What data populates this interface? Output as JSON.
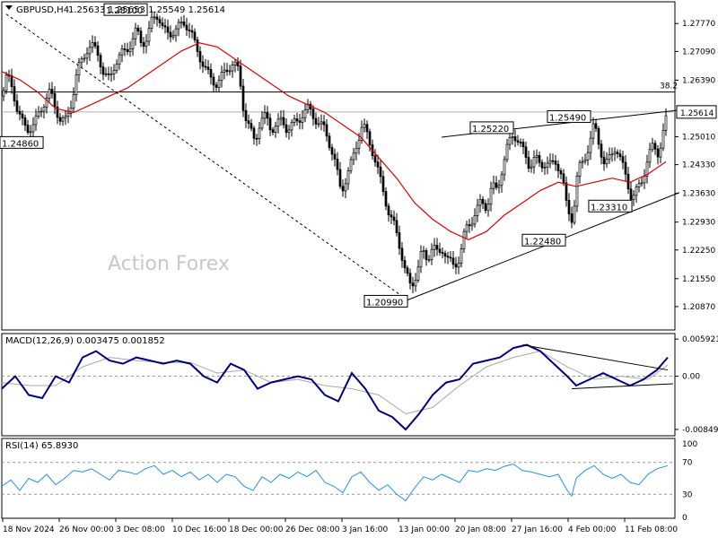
{
  "chart_data": [
    {
      "type": "candlestick",
      "symbol": "GBPUSD",
      "timeframe": "H4",
      "header": {
        "symbol_tf": "GBPUSD,H4",
        "ohlc": "1.25633 1.25653 1.25549 1.25614"
      },
      "last_price": "1.25614",
      "watermark": "Action Forex",
      "ylim": [
        1.203,
        1.283
      ],
      "y_ticks": [
        "1.27770",
        "1.27090",
        "1.26390",
        "1.25010",
        "1.24330",
        "1.23630",
        "1.22930",
        "1.22250",
        "1.21550",
        "1.20870"
      ],
      "x_ticks": [
        "18 Nov 2024",
        "26 Nov 00:00",
        "3 Dec 08:00",
        "10 Dec 16:00",
        "18 Dec 00:00",
        "26 Dec 08:00",
        "3 Jan 16:00",
        "13 Jan 00:00",
        "20 Jan 08:00",
        "27 Jan 16:00",
        "4 Feb 00:00",
        "11 Feb 08:00"
      ],
      "close_path": [
        [
          0,
          1.26
        ],
        [
          6,
          1.265
        ],
        [
          12,
          1.262
        ],
        [
          18,
          1.256
        ],
        [
          24,
          1.253
        ],
        [
          30,
          1.252
        ],
        [
          36,
          1.253
        ],
        [
          42,
          1.256
        ],
        [
          48,
          1.259
        ],
        [
          54,
          1.261
        ],
        [
          60,
          1.257
        ],
        [
          66,
          1.254
        ],
        [
          72,
          1.254
        ],
        [
          78,
          1.259
        ],
        [
          84,
          1.266
        ],
        [
          90,
          1.269
        ],
        [
          96,
          1.272
        ],
        [
          102,
          1.272
        ],
        [
          108,
          1.27
        ],
        [
          114,
          1.265
        ],
        [
          120,
          1.264
        ],
        [
          126,
          1.268
        ],
        [
          132,
          1.27
        ],
        [
          138,
          1.271
        ],
        [
          144,
          1.273
        ],
        [
          150,
          1.276
        ],
        [
          156,
          1.273
        ],
        [
          162,
          1.274
        ],
        [
          168,
          1.279
        ],
        [
          174,
          1.28
        ],
        [
          180,
          1.276
        ],
        [
          186,
          1.275
        ],
        [
          192,
          1.276
        ],
        [
          198,
          1.277
        ],
        [
          204,
          1.278
        ],
        [
          210,
          1.276
        ],
        [
          216,
          1.272
        ],
        [
          222,
          1.269
        ],
        [
          228,
          1.266
        ],
        [
          234,
          1.264
        ],
        [
          240,
          1.263
        ],
        [
          246,
          1.265
        ],
        [
          252,
          1.267
        ],
        [
          258,
          1.268
        ],
        [
          264,
          1.266
        ],
        [
          270,
          1.256
        ],
        [
          276,
          1.252
        ],
        [
          282,
          1.249
        ],
        [
          288,
          1.254
        ],
        [
          294,
          1.255
        ],
        [
          300,
          1.252
        ],
        [
          306,
          1.253
        ],
        [
          312,
          1.254
        ],
        [
          318,
          1.252
        ],
        [
          324,
          1.253
        ],
        [
          330,
          1.254
        ],
        [
          336,
          1.256
        ],
        [
          342,
          1.257
        ],
        [
          348,
          1.255
        ],
        [
          354,
          1.253
        ],
        [
          360,
          1.252
        ],
        [
          366,
          1.248
        ],
        [
          372,
          1.243
        ],
        [
          378,
          1.237
        ],
        [
          384,
          1.24
        ],
        [
          390,
          1.244
        ],
        [
          396,
          1.249
        ],
        [
          402,
          1.253
        ],
        [
          408,
          1.25
        ],
        [
          414,
          1.246
        ],
        [
          420,
          1.241
        ],
        [
          426,
          1.236
        ],
        [
          432,
          1.231
        ],
        [
          438,
          1.228
        ],
        [
          444,
          1.223
        ],
        [
          450,
          1.217
        ],
        [
          456,
          1.213
        ],
        [
          462,
          1.217
        ],
        [
          468,
          1.222
        ],
        [
          474,
          1.22
        ],
        [
          480,
          1.224
        ],
        [
          486,
          1.221
        ],
        [
          492,
          1.223
        ],
        [
          498,
          1.22
        ],
        [
          504,
          1.218
        ],
        [
          510,
          1.221
        ],
        [
          516,
          1.227
        ],
        [
          522,
          1.229
        ],
        [
          528,
          1.232
        ],
        [
          534,
          1.234
        ],
        [
          540,
          1.233
        ],
        [
          546,
          1.238
        ],
        [
          552,
          1.237
        ],
        [
          558,
          1.243
        ],
        [
          564,
          1.248
        ],
        [
          570,
          1.251
        ],
        [
          576,
          1.249
        ],
        [
          582,
          1.246
        ],
        [
          588,
          1.243
        ],
        [
          594,
          1.245
        ],
        [
          600,
          1.243
        ],
        [
          606,
          1.244
        ],
        [
          612,
          1.243
        ],
        [
          618,
          1.244
        ],
        [
          624,
          1.241
        ],
        [
          630,
          1.232
        ],
        [
          636,
          1.23
        ],
        [
          642,
          1.242
        ],
        [
          648,
          1.244
        ],
        [
          654,
          1.248
        ],
        [
          660,
          1.253
        ],
        [
          666,
          1.248
        ],
        [
          672,
          1.243
        ],
        [
          678,
          1.245
        ],
        [
          684,
          1.248
        ],
        [
          690,
          1.244
        ],
        [
          696,
          1.24
        ],
        [
          702,
          1.235
        ],
        [
          708,
          1.237
        ],
        [
          714,
          1.24
        ],
        [
          720,
          1.245
        ],
        [
          726,
          1.248
        ],
        [
          732,
          1.246
        ],
        [
          738,
          1.252
        ],
        [
          742,
          1.2561
        ]
      ],
      "ma_path": [
        [
          0,
          1.266
        ],
        [
          20,
          1.264
        ],
        [
          40,
          1.261
        ],
        [
          60,
          1.257
        ],
        [
          80,
          1.256
        ],
        [
          100,
          1.258
        ],
        [
          120,
          1.26
        ],
        [
          140,
          1.262
        ],
        [
          160,
          1.265
        ],
        [
          180,
          1.268
        ],
        [
          200,
          1.271
        ],
        [
          220,
          1.273
        ],
        [
          240,
          1.272
        ],
        [
          260,
          1.269
        ],
        [
          280,
          1.266
        ],
        [
          300,
          1.263
        ],
        [
          320,
          1.26
        ],
        [
          340,
          1.258
        ],
        [
          360,
          1.256
        ],
        [
          380,
          1.253
        ],
        [
          400,
          1.25
        ],
        [
          420,
          1.245
        ],
        [
          440,
          1.24
        ],
        [
          460,
          1.234
        ],
        [
          480,
          1.23
        ],
        [
          500,
          1.227
        ],
        [
          520,
          1.225
        ],
        [
          540,
          1.227
        ],
        [
          560,
          1.231
        ],
        [
          580,
          1.234
        ],
        [
          600,
          1.237
        ],
        [
          620,
          1.239
        ],
        [
          640,
          1.238
        ],
        [
          660,
          1.239
        ],
        [
          680,
          1.24
        ],
        [
          700,
          1.239
        ],
        [
          720,
          1.241
        ],
        [
          740,
          1.244
        ]
      ],
      "labels": [
        {
          "text": "1.28100",
          "value": 1.281,
          "x": 138
        },
        {
          "text": "1.24860",
          "value": 1.2486,
          "x": 22
        },
        {
          "text": "1.25220",
          "value": 1.2522,
          "x": 546
        },
        {
          "text": "1.25490",
          "value": 1.2549,
          "x": 632
        },
        {
          "text": "1.23310",
          "value": 1.2331,
          "x": 678
        },
        {
          "text": "1.22480",
          "value": 1.2248,
          "x": 604
        },
        {
          "text": "1.20990",
          "value": 1.2099,
          "x": 428
        }
      ],
      "fib_label": "38.2",
      "fib_level": 1.261,
      "trendlines": [
        {
          "style": "dashed",
          "from": [
            5,
            1.28
          ],
          "to": [
            452,
            1.2103
          ]
        },
        {
          "style": "solid",
          "from": [
            452,
            1.2103
          ],
          "to": [
            755,
            1.2365
          ]
        },
        {
          "style": "solid",
          "from": [
            490,
            1.25
          ],
          "to": [
            755,
            1.2566
          ]
        }
      ]
    },
    {
      "type": "line",
      "name": "MACD",
      "label": "MACD(12,26,9) 0.003475 0.001852",
      "ylim": [
        -0.0095,
        0.0068
      ],
      "y_ticks": [
        "0.005921",
        "0.00",
        "-0.00849"
      ],
      "macd_path": [
        [
          0,
          -0.002
        ],
        [
          15,
          0.0
        ],
        [
          30,
          -0.003
        ],
        [
          45,
          -0.0035
        ],
        [
          60,
          0.0
        ],
        [
          75,
          -0.001
        ],
        [
          90,
          0.003
        ],
        [
          105,
          0.004
        ],
        [
          120,
          0.0025
        ],
        [
          135,
          0.002
        ],
        [
          150,
          0.003
        ],
        [
          165,
          0.0025
        ],
        [
          180,
          0.002
        ],
        [
          195,
          0.0025
        ],
        [
          210,
          0.002
        ],
        [
          225,
          0.0
        ],
        [
          240,
          -0.001
        ],
        [
          255,
          0.002
        ],
        [
          270,
          0.001
        ],
        [
          285,
          -0.002
        ],
        [
          300,
          -0.001
        ],
        [
          315,
          -0.0005
        ],
        [
          330,
          0.0
        ],
        [
          345,
          -0.0005
        ],
        [
          360,
          -0.003
        ],
        [
          375,
          -0.004
        ],
        [
          390,
          0.0005
        ],
        [
          405,
          -0.002
        ],
        [
          420,
          -0.0055
        ],
        [
          435,
          -0.0065
        ],
        [
          450,
          -0.0085
        ],
        [
          465,
          -0.006
        ],
        [
          480,
          -0.003
        ],
        [
          495,
          -0.001
        ],
        [
          510,
          -0.0005
        ],
        [
          525,
          0.002
        ],
        [
          540,
          0.0025
        ],
        [
          555,
          0.003
        ],
        [
          570,
          0.0045
        ],
        [
          585,
          0.005
        ],
        [
          600,
          0.004
        ],
        [
          615,
          0.002
        ],
        [
          630,
          0.0
        ],
        [
          640,
          -0.0015
        ],
        [
          655,
          -0.0005
        ],
        [
          670,
          0.0005
        ],
        [
          685,
          -0.0005
        ],
        [
          700,
          -0.0015
        ],
        [
          715,
          -0.0005
        ],
        [
          730,
          0.001
        ],
        [
          742,
          0.003
        ]
      ],
      "signal_path": [
        [
          0,
          -0.001
        ],
        [
          30,
          -0.0015
        ],
        [
          60,
          -0.0015
        ],
        [
          90,
          0.0015
        ],
        [
          120,
          0.003
        ],
        [
          150,
          0.0025
        ],
        [
          180,
          0.0022
        ],
        [
          210,
          0.0022
        ],
        [
          240,
          0.0005
        ],
        [
          270,
          0.001
        ],
        [
          300,
          -0.001
        ],
        [
          330,
          -0.0005
        ],
        [
          360,
          -0.0015
        ],
        [
          390,
          -0.002
        ],
        [
          420,
          -0.003
        ],
        [
          450,
          -0.006
        ],
        [
          480,
          -0.005
        ],
        [
          510,
          -0.0015
        ],
        [
          540,
          0.0015
        ],
        [
          570,
          0.003
        ],
        [
          600,
          0.004
        ],
        [
          630,
          0.0015
        ],
        [
          660,
          -0.0005
        ],
        [
          690,
          0.0
        ],
        [
          720,
          -0.0005
        ],
        [
          742,
          0.0018
        ]
      ],
      "trendlines": [
        {
          "from": [
            580,
            0.005
          ],
          "to": [
            742,
            0.001
          ]
        },
        {
          "from": [
            635,
            -0.002
          ],
          "to": [
            748,
            -0.0012
          ]
        }
      ]
    },
    {
      "type": "line",
      "name": "RSI",
      "label": "RSI(14) 65.8930",
      "ylim": [
        0,
        100
      ],
      "y_ticks": [
        "100",
        "70",
        "30",
        "0"
      ],
      "levels": [
        70,
        30
      ],
      "rsi_path": [
        [
          0,
          40
        ],
        [
          10,
          48
        ],
        [
          20,
          35
        ],
        [
          30,
          50
        ],
        [
          40,
          45
        ],
        [
          50,
          55
        ],
        [
          60,
          42
        ],
        [
          70,
          50
        ],
        [
          80,
          60
        ],
        [
          90,
          58
        ],
        [
          100,
          62
        ],
        [
          110,
          55
        ],
        [
          120,
          48
        ],
        [
          130,
          60
        ],
        [
          140,
          58
        ],
        [
          150,
          55
        ],
        [
          160,
          62
        ],
        [
          170,
          66
        ],
        [
          180,
          55
        ],
        [
          190,
          60
        ],
        [
          200,
          52
        ],
        [
          210,
          58
        ],
        [
          220,
          48
        ],
        [
          230,
          55
        ],
        [
          240,
          45
        ],
        [
          250,
          55
        ],
        [
          260,
          52
        ],
        [
          270,
          40
        ],
        [
          280,
          35
        ],
        [
          290,
          52
        ],
        [
          300,
          45
        ],
        [
          310,
          55
        ],
        [
          320,
          50
        ],
        [
          330,
          58
        ],
        [
          340,
          52
        ],
        [
          350,
          60
        ],
        [
          360,
          45
        ],
        [
          370,
          40
        ],
        [
          380,
          32
        ],
        [
          390,
          52
        ],
        [
          400,
          58
        ],
        [
          410,
          45
        ],
        [
          420,
          35
        ],
        [
          430,
          42
        ],
        [
          440,
          30
        ],
        [
          450,
          22
        ],
        [
          460,
          38
        ],
        [
          470,
          52
        ],
        [
          480,
          48
        ],
        [
          490,
          55
        ],
        [
          500,
          50
        ],
        [
          510,
          45
        ],
        [
          520,
          60
        ],
        [
          530,
          58
        ],
        [
          540,
          62
        ],
        [
          550,
          60
        ],
        [
          560,
          65
        ],
        [
          570,
          68
        ],
        [
          580,
          60
        ],
        [
          590,
          58
        ],
        [
          600,
          55
        ],
        [
          610,
          52
        ],
        [
          620,
          55
        ],
        [
          630,
          35
        ],
        [
          635,
          28
        ],
        [
          640,
          50
        ],
        [
          650,
          60
        ],
        [
          660,
          66
        ],
        [
          670,
          55
        ],
        [
          680,
          50
        ],
        [
          690,
          55
        ],
        [
          700,
          45
        ],
        [
          710,
          42
        ],
        [
          720,
          55
        ],
        [
          730,
          62
        ],
        [
          742,
          66
        ]
      ]
    }
  ]
}
